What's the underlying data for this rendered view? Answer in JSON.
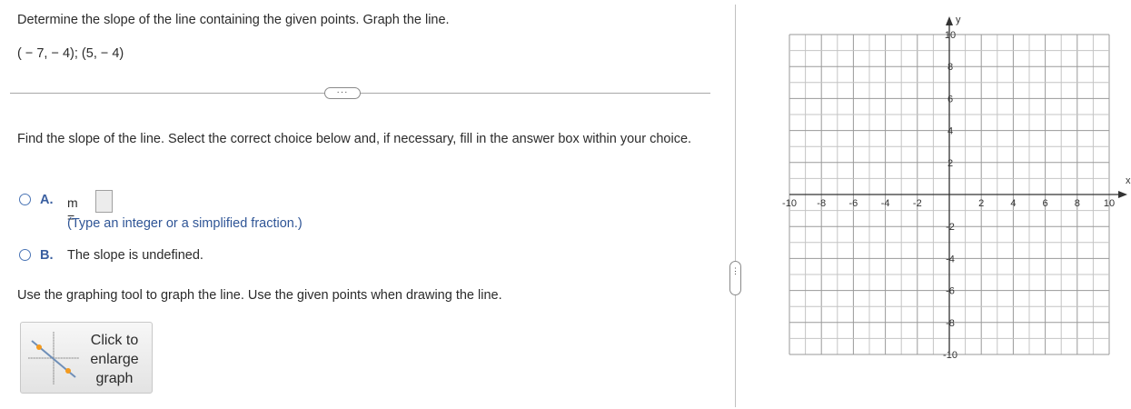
{
  "question": {
    "prompt": "Determine the slope of the line containing the given points. Graph the line.",
    "points": "( − 7, − 4); (5, − 4)"
  },
  "more_button": {
    "label": "···"
  },
  "instruction": "Find the slope of the line. Select the correct choice below and, if necessary, fill in the answer box within your choice.",
  "choices": [
    {
      "letter": "A.",
      "m_label": "m =",
      "answer_value": "",
      "hint": "(Type an integer or a simplified fraction.)"
    },
    {
      "letter": "B.",
      "text": "The slope is undefined."
    }
  ],
  "graph_instruction": "Use the graphing tool to graph the line.  Use the given points when drawing the line.",
  "enlarge_button": {
    "label": "Click to enlarge graph"
  },
  "splitter": {
    "label": "⋮"
  },
  "graph": {
    "x_axis_label": "x",
    "y_axis_label": "y",
    "x_ticks": [
      "-10",
      "-8",
      "-6",
      "-4",
      "-2",
      "2",
      "4",
      "6",
      "8",
      "10"
    ],
    "y_ticks": [
      "10",
      "8",
      "6",
      "4",
      "2",
      "-2",
      "-4",
      "-6",
      "-8",
      "-10"
    ],
    "x_range": [
      -10,
      10
    ],
    "y_range": [
      -10,
      10
    ]
  }
}
